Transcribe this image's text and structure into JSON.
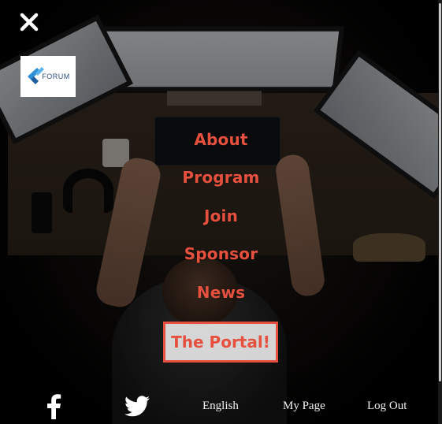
{
  "header": {
    "close_icon": "close-icon",
    "logo_text": "FORUM"
  },
  "menu": {
    "items": [
      {
        "label": "About"
      },
      {
        "label": "Program"
      },
      {
        "label": "Join"
      },
      {
        "label": "Sponsor"
      },
      {
        "label": "News"
      }
    ],
    "portal_label": "The Portal!"
  },
  "footer": {
    "social": [
      {
        "icon": "facebook-icon"
      },
      {
        "icon": "twitter-icon"
      }
    ],
    "links": {
      "language": "English",
      "my_page": "My Page",
      "logout": "Log Out"
    }
  },
  "colors": {
    "accent": "#e5503f",
    "background": "#000000",
    "footer_text": "#f2f2f2"
  }
}
